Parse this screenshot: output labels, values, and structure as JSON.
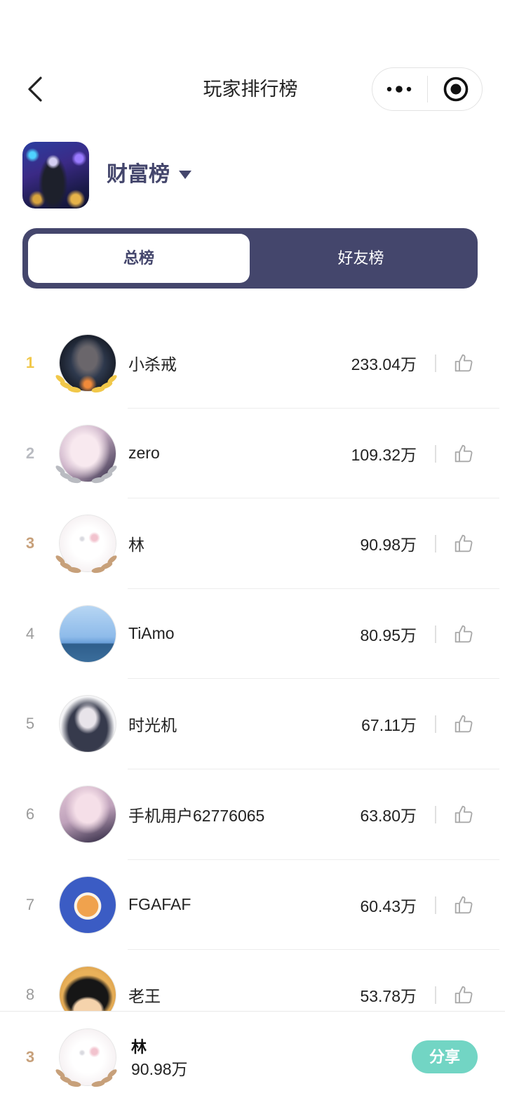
{
  "header": {
    "title": "玩家排行榜",
    "back_icon": "chevron-left-icon",
    "more_icon": "more-dots-icon",
    "close_icon": "target-circle-icon"
  },
  "board": {
    "name": "财富榜",
    "dropdown_icon": "caret-down-icon"
  },
  "tabs": [
    {
      "label": "总榜",
      "selected": true
    },
    {
      "label": "好友榜",
      "selected": false
    }
  ],
  "leaderboard": [
    {
      "rank": "1",
      "name": "小杀戒",
      "score": "233.04万"
    },
    {
      "rank": "2",
      "name": "zero",
      "score": "109.32万"
    },
    {
      "rank": "3",
      "name": "林",
      "score": "90.98万"
    },
    {
      "rank": "4",
      "name": "TiAmo",
      "score": "80.95万"
    },
    {
      "rank": "5",
      "name": "时光机",
      "score": "67.11万"
    },
    {
      "rank": "6",
      "name": "手机用户62776065",
      "score": "63.80万"
    },
    {
      "rank": "7",
      "name": "FGAFAF",
      "score": "60.43万"
    },
    {
      "rank": "8",
      "name": "老王",
      "score": "53.78万"
    }
  ],
  "like_icon": "thumbs-up-icon",
  "top3_badge_icon": "laurel-wreath-icon",
  "my_rank": {
    "rank": "3",
    "name": "林",
    "score": "90.98万",
    "share_label": "分享"
  },
  "colors": {
    "brand": "#44466c",
    "rank_1": "#f1c84a",
    "rank_2": "#b9bbc1",
    "rank_3": "#c7a07a",
    "rank_other": "#9b9b9b",
    "share": "#72d5c4",
    "icon_gray": "#a9a9a9",
    "text": "#222222",
    "divider": "#ededed"
  }
}
